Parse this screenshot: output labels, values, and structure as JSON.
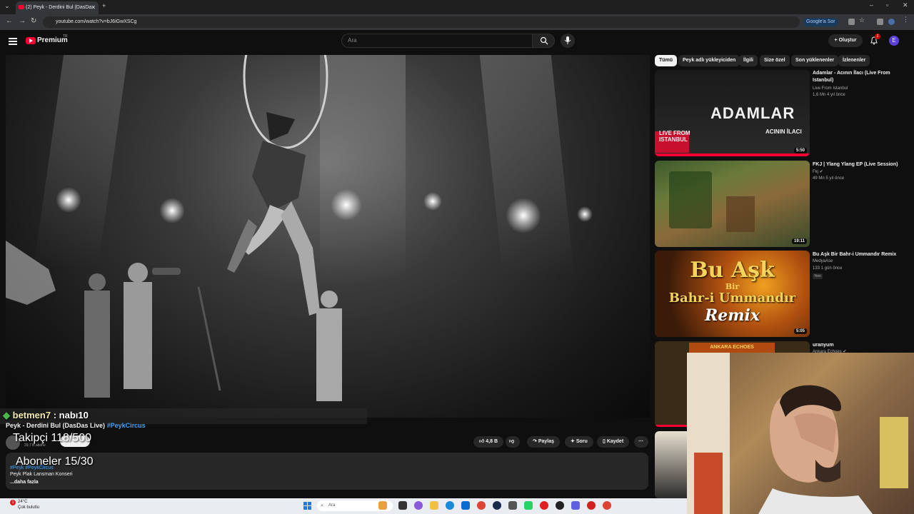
{
  "browser": {
    "tab_title": "(2) Peyk - Derdini Bul (DasDa",
    "url": "youtube.com/watch?v=bJ6iGwXSCg",
    "google_ask": "Google'a Sor"
  },
  "header": {
    "logo_text": "Premium",
    "logo_region": "TR",
    "search_placeholder": "Ara",
    "create_label": "Oluştur",
    "notification_count": "2",
    "avatar_letter": "E"
  },
  "overlays": {
    "follower_user": "betmen7",
    "follower_sep": " : nabı10",
    "takipci": "Takipçi 118/500",
    "aboneler": "Aboneler 15/30"
  },
  "video": {
    "title": "Peyk - Derdini Bul (DasDas Live)",
    "title_tag": "#PeykCircus",
    "channel_subs": "29,7 B abone",
    "likes": "4,8 B",
    "share_label": "Paylaş",
    "ask_label": "Soru",
    "save_label": "Kaydet",
    "desc_tags": "#Peyk #PeykCircus",
    "desc_text": "Peyk Plak Lansman Konseri",
    "desc_more": "...daha fazla"
  },
  "chips": [
    "Tümü",
    "Peyk adlı yükleyiciden",
    "İlgili",
    "Size özel",
    "Son yüklenenler",
    "İzlenenler"
  ],
  "recommendations": [
    {
      "title": "Adamlar - Acının İlacı (Live From Istanbul)",
      "channel": "Live From Istanbul",
      "meta": "1,6 Mn  4 yıl önce",
      "duration": "5:50",
      "thumb_text": "ADAMLAR",
      "thumb_sub": "ACININ İLACI",
      "thumb_live": "LIVE FROM ISTANBUL",
      "badge": ""
    },
    {
      "title": "FKJ | Ylang Ylang EP (Live Session)",
      "channel": "Fkj",
      "meta": "49 Mn  5 yıl önce",
      "duration": "19:11",
      "thumb_text": "",
      "thumb_sub": "",
      "thumb_live": "",
      "badge": ""
    },
    {
      "title": "Bu Aşk Bir Bahr-i Ummandır Remix",
      "channel": "MedyaAse",
      "meta": "133  1 gün önce",
      "duration": "5:05",
      "thumb_text": "Bu Aşk",
      "thumb_sub": "Bir",
      "thumb_live": "Bahr-i Ummandır",
      "thumb_remix": "Remix",
      "badge": "Yeni"
    },
    {
      "title": "uranyum",
      "channel": "Ankara Echoes",
      "meta": "",
      "duration": "",
      "thumb_text": "ANKARA ECHOES",
      "thumb_sub": "",
      "thumb_live": "",
      "badge": ""
    }
  ],
  "taskbar": {
    "temp": "24°C",
    "weather": "Çok bulutlu",
    "search_placeholder": "Ara"
  },
  "icons": {
    "menu": "hamburger-icon",
    "search": "search-icon",
    "mic": "mic-icon",
    "bell": "bell-icon",
    "like": "thumbs-up-icon",
    "dislike": "thumbs-down-icon",
    "share": "share-icon",
    "save": "bookmark-icon"
  },
  "colors": {
    "brand": "#ff0033",
    "link": "#3ea6ff",
    "follower_name": "#f3e9a8"
  }
}
